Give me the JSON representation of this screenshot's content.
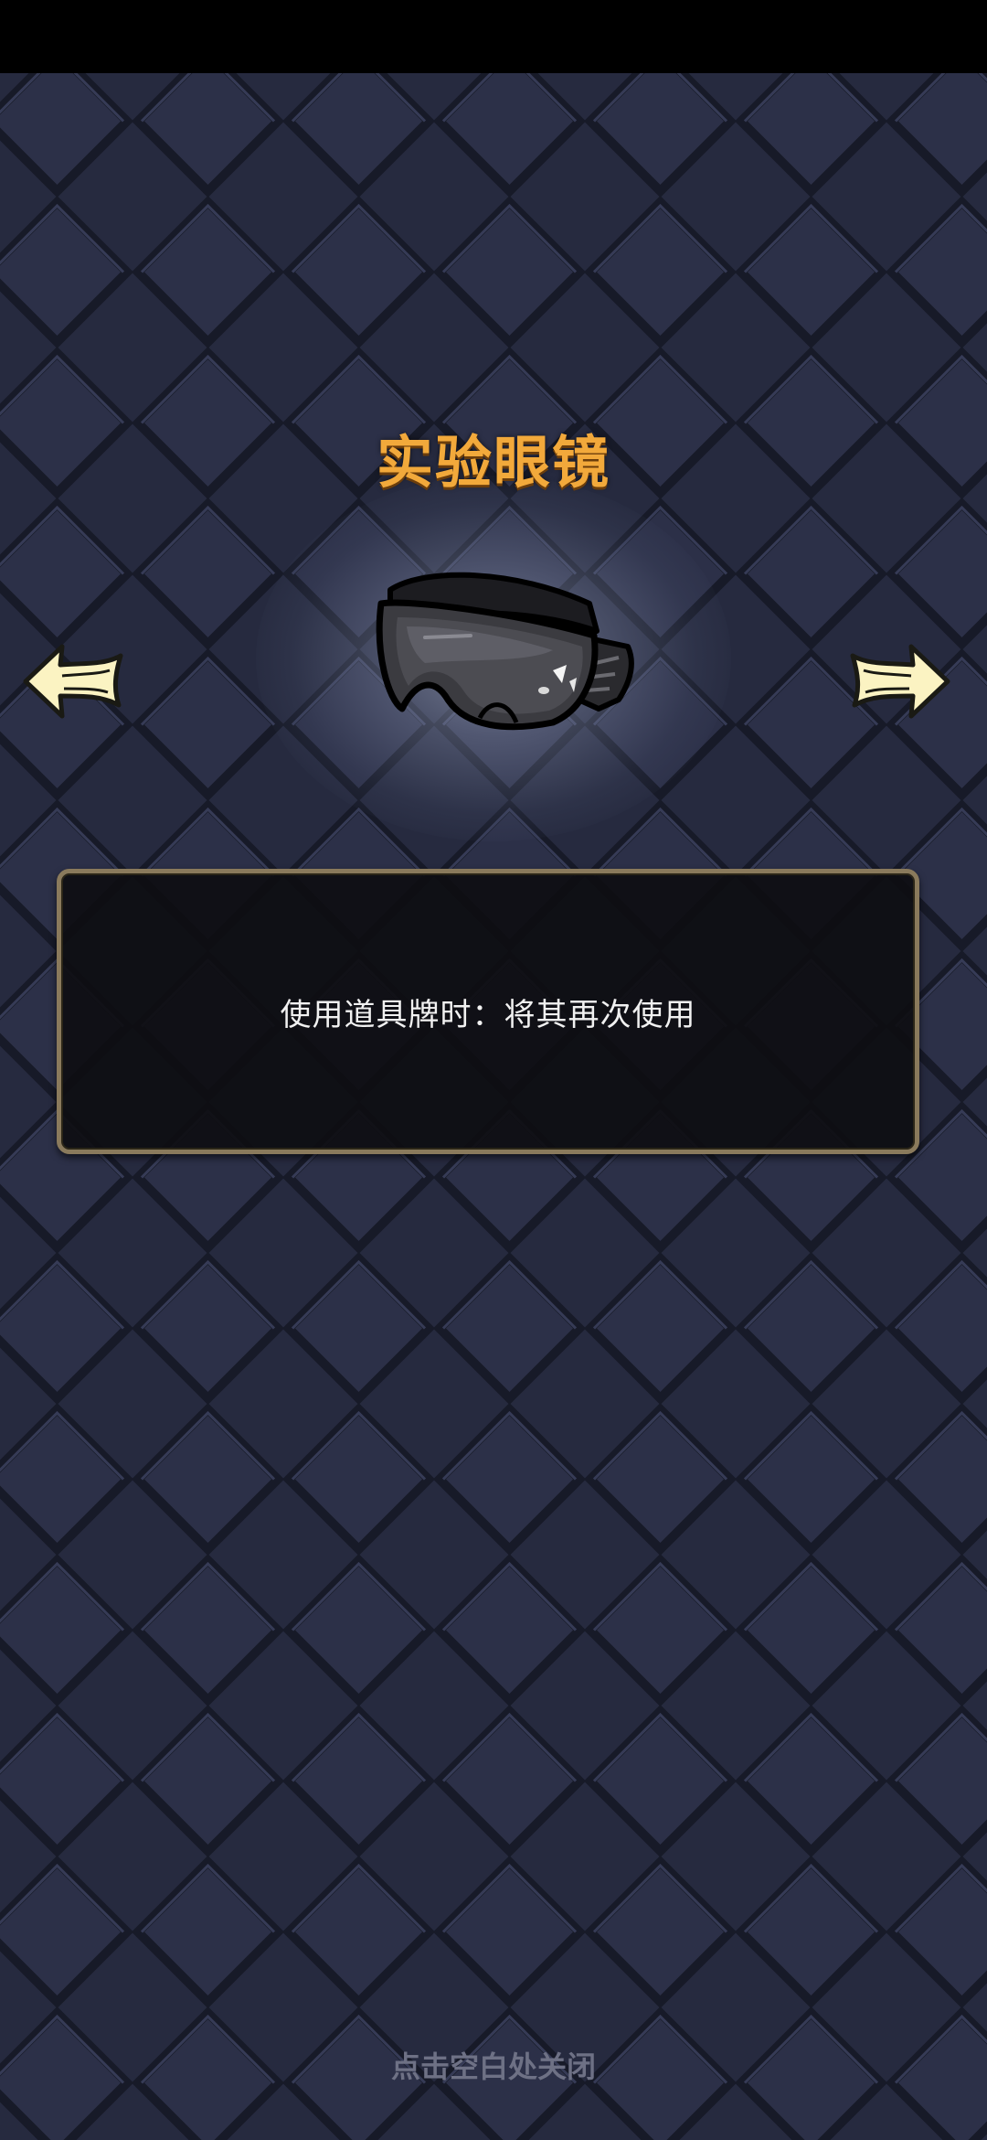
{
  "item": {
    "title": "实验眼镜",
    "image_icon": "goggles-icon",
    "description": "使用道具牌时：将其再次使用"
  },
  "navigation": {
    "prev_icon": "arrow-left-icon",
    "next_icon": "arrow-right-icon"
  },
  "footer": {
    "close_hint": "点击空白处关闭"
  },
  "colors": {
    "background": "#23263a",
    "title": "#f2a93b",
    "panel_border": "#8a7a5c",
    "panel_fill": "#0e0e12",
    "arrow_fill": "#fbf3c2"
  }
}
